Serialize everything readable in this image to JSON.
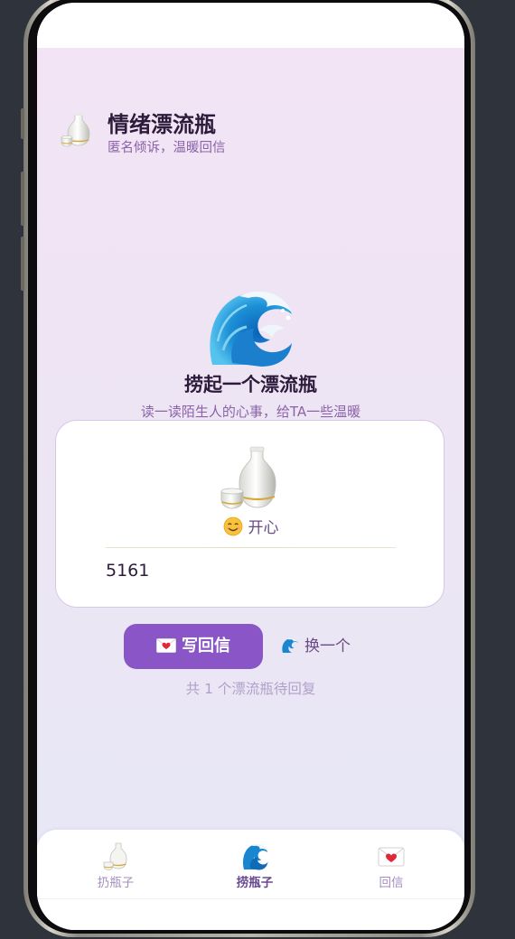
{
  "header": {
    "logo_icon": "sake-bottle-icon",
    "title": "情绪漂流瓶",
    "subtitle": "匿名倾诉，温暖回信"
  },
  "hero": {
    "icon": "water-wave-icon",
    "title": "捞起一个漂流瓶",
    "subtitle": "读一读陌生人的心事，给TA一些温暖"
  },
  "bottle_card": {
    "icon": "sake-bottle-icon",
    "mood_icon": "smiling-face-icon",
    "mood_label": "开心",
    "message": "5161"
  },
  "actions": {
    "reply_label": "写回信",
    "reply_icon": "love-letter-icon",
    "change_label": "换一个",
    "change_icon": "water-wave-icon"
  },
  "pending_text": "共 1 个漂流瓶待回复",
  "tabs": [
    {
      "label": "扔瓶子",
      "icon": "sake-bottle-icon",
      "active": false
    },
    {
      "label": "捞瓶子",
      "icon": "water-wave-icon",
      "active": true
    },
    {
      "label": "回信",
      "icon": "love-letter-icon",
      "active": false
    }
  ],
  "colors": {
    "accent": "#8a56c7",
    "title_text": "#2e1b3b",
    "subtitle_text": "#8a63a8",
    "background_top": "#f2e4f5",
    "background_bottom": "#e6e8f6"
  }
}
